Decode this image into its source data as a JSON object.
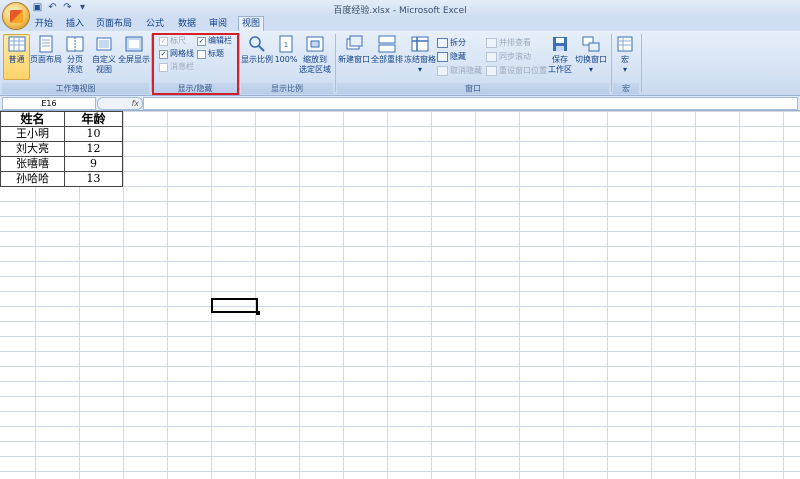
{
  "window": {
    "title": "百度经验.xlsx - Microsoft Excel"
  },
  "tabs": [
    "开始",
    "插入",
    "页面布局",
    "公式",
    "数据",
    "审阅",
    "视图"
  ],
  "active_tab": "视图",
  "ribbon": {
    "workbook_views": {
      "label": "工作簿视图",
      "normal": "普通",
      "page_layout": "页面布局",
      "page_break_1": "分页",
      "page_break_2": "预览",
      "custom_1": "自定义",
      "custom_2": "视图",
      "full_screen": "全屏显示"
    },
    "show_hide": {
      "label": "显示/隐藏",
      "ruler": "标尺",
      "gridlines": "网格线",
      "message_bar": "消息栏",
      "formula_bar": "编辑栏",
      "headings": "标题"
    },
    "zoom": {
      "label": "显示比例",
      "zoom": "显示比例",
      "hundred": "100%",
      "to_sel_1": "缩放到",
      "to_sel_2": "选定区域"
    },
    "window": {
      "label": "窗口",
      "new_window": "新建窗口",
      "arrange_all": "全部重排",
      "freeze": "冻结窗格",
      "split": "拆分",
      "hide": "隐藏",
      "unhide": "取消隐藏",
      "side_by_side": "并排查看",
      "sync_scroll": "同步滚动",
      "reset_pos": "重设窗口位置",
      "save_ws_1": "保存",
      "save_ws_2": "工作区",
      "switch": "切换窗口"
    },
    "macros": {
      "label": "宏",
      "button": "宏"
    }
  },
  "formula_bar": {
    "name_box": "E16",
    "fx": "fx"
  },
  "sheet": {
    "headers": [
      "姓名",
      "年龄"
    ],
    "rows": [
      [
        "王小明",
        "10"
      ],
      [
        "刘大亮",
        "12"
      ],
      [
        "张嘻嘻",
        "9"
      ],
      [
        "孙哈哈",
        "13"
      ]
    ]
  }
}
